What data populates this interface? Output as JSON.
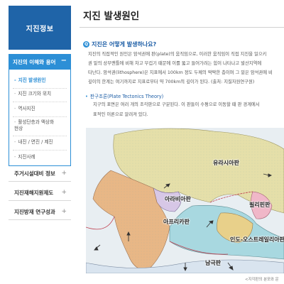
{
  "sidebar": {
    "header": "지진정보",
    "active_section": "지진의 이해와 용어",
    "active_toggle": "−",
    "sub_items": [
      {
        "label": "지진 발생원인",
        "dash": "-"
      },
      {
        "label": "지진 크기와 위치",
        "dash": "-"
      },
      {
        "label": "역사지진",
        "dash": "-"
      },
      {
        "label": "활성단층과 액상화",
        "label2": "현상",
        "dash": "-"
      },
      {
        "label": "내진 / 면진 / 제진",
        "dash": "-"
      },
      {
        "label": "지진사례",
        "dash": "-"
      }
    ],
    "main_items": [
      {
        "label": "주거시설대비 정보",
        "toggle": "+"
      },
      {
        "label": "지진재해지원제도",
        "toggle": "+"
      },
      {
        "label": "지진방재 연구성과",
        "toggle": "+"
      }
    ]
  },
  "content": {
    "title": "지진 발생원인",
    "question_icon": "Q",
    "question": "지진은 어떻게 발생하나요?",
    "paragraph_lines": [
      "지진의 직접적인 원인은 암석권에 판(plate)의 움직임으로, 이러한 움직임이 직접 지진을 일으키",
      "권 밑의 상부맨틀에 비해 차고 무겁기 때문에 이를 뚫고 들어가려는 힘이 나타나고 발산지역에",
      "타난다. 암석권(lithosphere)은 지표에서 100km 정도 두께의 딱딱한 층이며 그 밑은 암석권에 비",
      "깊이의 한계는 여기까지로 지표로부터 약 700km의 깊이가 된다. (출처: 지질자원연구원)"
    ],
    "subheading_bullet": "•",
    "subheading": "판구조론(Plate Tectonics Theory)",
    "sub_paragraph_lines": [
      "지구의 표면은 여러 개의 조각판으로 구분된다. 이 판들이 수평으로 이동할 때 판 경계에서",
      "표적인 이론으로 알려져 있다."
    ],
    "map_labels": {
      "eurasia": "유라시아판",
      "arabia": "아라비아판",
      "philippine": "필리핀판",
      "africa": "아프리카판",
      "indo_australia": "인도-오스트레일리아판",
      "antarctic": "남극판"
    },
    "caption": "<지각판의 분포와 운"
  }
}
